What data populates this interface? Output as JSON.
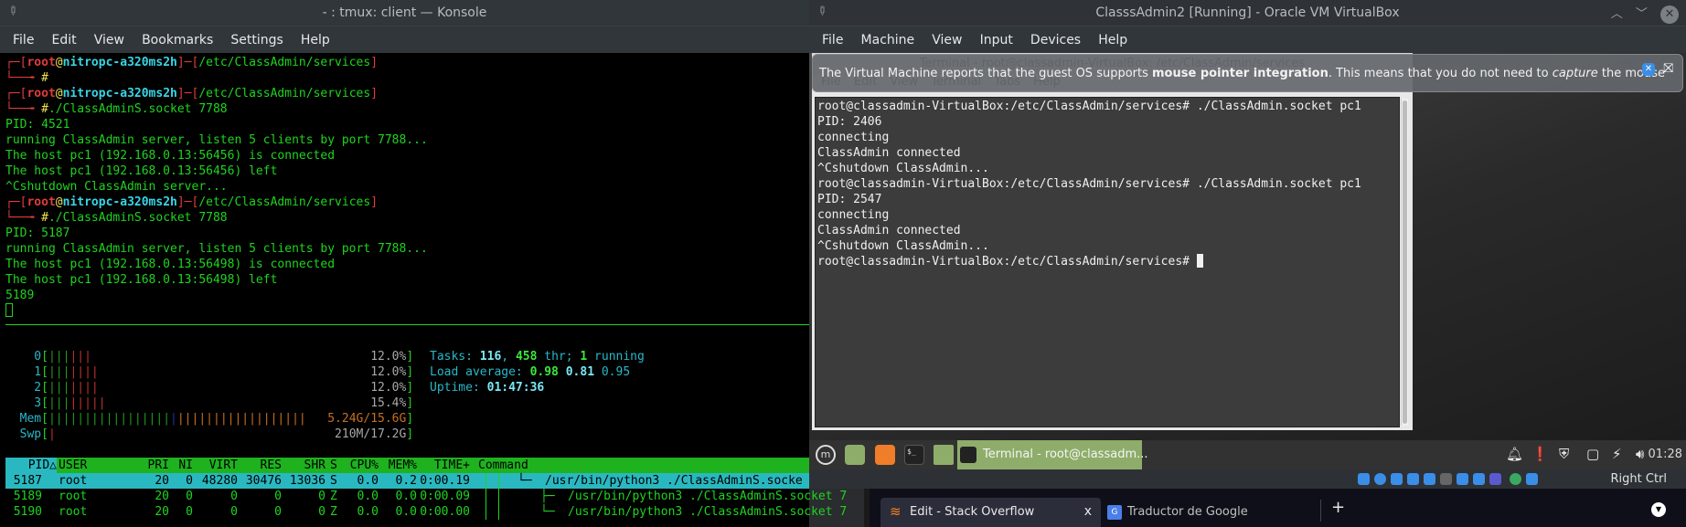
{
  "konsole": {
    "title": "- : tmux: client — Konsole",
    "menu": [
      "File",
      "Edit",
      "View",
      "Bookmarks",
      "Settings",
      "Help"
    ],
    "prompt": {
      "user": "root",
      "at": "@",
      "host": "nitropc-a320ms2h",
      "path": "/etc/ClassAdmin/services",
      "symbol": "#"
    },
    "lines": [
      {
        "type": "prompt"
      },
      {
        "type": "cmd",
        "text": ""
      },
      {
        "type": "prompt"
      },
      {
        "type": "cmd",
        "text": "./ClassAdminS.socket 7788"
      },
      {
        "type": "out",
        "text": "PID: 4521"
      },
      {
        "type": "out",
        "text": "running ClassAdmin server, listen 5 clients by port 7788..."
      },
      {
        "type": "out",
        "text": "The host pc1 (192.168.0.13:56456) is connected"
      },
      {
        "type": "out",
        "text": "The host pc1 (192.168.0.13:56456) left"
      },
      {
        "type": "out",
        "text": "^Cshutdown ClassAdmin server..."
      },
      {
        "type": "prompt"
      },
      {
        "type": "cmd",
        "text": "./ClassAdminS.socket 7788"
      },
      {
        "type": "out",
        "text": "PID: 5187"
      },
      {
        "type": "out",
        "text": "running ClassAdmin server, listen 5 clients by port 7788..."
      },
      {
        "type": "out",
        "text": "The host pc1 (192.168.0.13:56498) is connected"
      },
      {
        "type": "out",
        "text": "The host pc1 (192.168.0.13:56498) left"
      },
      {
        "type": "out",
        "text": "5189"
      }
    ]
  },
  "htop": {
    "cpus": [
      {
        "label": "0",
        "percent": "12.0%",
        "green_bars": 3,
        "red_bars": 3
      },
      {
        "label": "1",
        "percent": "12.0%",
        "green_bars": 3,
        "red_bars": 4
      },
      {
        "label": "2",
        "percent": "12.0%",
        "green_bars": 3,
        "red_bars": 4
      },
      {
        "label": "3",
        "percent": "15.4%",
        "green_bars": 3,
        "red_bars": 5
      }
    ],
    "mem": {
      "label": "Mem",
      "value": "5.24G/15.6G",
      "green_bars": 17,
      "blue_bars": 1,
      "orange_bars": 18
    },
    "swp": {
      "label": "Swp",
      "value": "210M/17.2G",
      "red_bars": 1
    },
    "tasks": {
      "label": "Tasks:",
      "count": "116",
      "threads": "458",
      "thr_label": "thr;",
      "running": "1",
      "running_label": "running"
    },
    "load": {
      "label": "Load average:",
      "l1": "0.98",
      "l5": "0.81",
      "l15": "0.95"
    },
    "uptime": {
      "label": "Uptime:",
      "value": "01:47:36"
    },
    "columns": [
      "PID",
      "USER",
      "PRI",
      "NI",
      "VIRT",
      "RES",
      "SHR",
      "S",
      "CPU%",
      "MEM%",
      "TIME+",
      "Command"
    ],
    "sort_indicator": "△",
    "processes": [
      {
        "pid": "5187",
        "user": "root",
        "pri": "20",
        "ni": "0",
        "virt": "48280",
        "res": "30476",
        "shr": "13036",
        "s": "S",
        "cpu": "0.0",
        "mem": "0.2",
        "time": "0:00.19",
        "tree": "└─",
        "command": "/usr/bin/python3 ./ClassAdminS.socke"
      },
      {
        "pid": "5189",
        "user": "root",
        "pri": "20",
        "ni": "0",
        "virt": "0",
        "res": "0",
        "shr": "0",
        "s": "Z",
        "cpu": "0.0",
        "mem": "0.0",
        "time": "0:00.09",
        "tree": "├─",
        "command": "/usr/bin/python3 ./ClassAdminS.socket 7"
      },
      {
        "pid": "5190",
        "user": "root",
        "pri": "20",
        "ni": "0",
        "virt": "0",
        "res": "0",
        "shr": "0",
        "s": "Z",
        "cpu": "0.0",
        "mem": "0.0",
        "time": "0:00.00",
        "tree": "└─",
        "command": "/usr/bin/python3 ./ClassAdminS.socket 7"
      }
    ]
  },
  "vbox": {
    "title": "ClasssAdmin2 [Running] - Oracle VM VirtualBox",
    "menu": [
      "File",
      "Machine",
      "View",
      "Input",
      "Devices",
      "Help"
    ],
    "notification": {
      "pre": "The Virtual Machine reports that the guest OS supports ",
      "bold": "mouse pointer integration",
      "mid": ". This means that you do not need to ",
      "italic": "capture",
      "post": " the mouse"
    },
    "guest_terminal": {
      "title": "Terminal - root@classadmin-VirtualBox: /etc/ClassAdmin/services",
      "menu": [
        "File",
        "Edit",
        "View",
        "Terminal",
        "Tabs",
        "Help"
      ],
      "lines": [
        "root@classadmin-VirtualBox:/etc/ClassAdmin/services# ./ClassAdmin.socket pc1",
        "PID: 2406",
        "connecting",
        "ClassAdmin connected",
        "^Cshutdown ClassAdmin...",
        "root@classadmin-VirtualBox:/etc/ClassAdmin/services# ./ClassAdmin.socket pc1",
        "PID: 2547",
        "connecting",
        "ClassAdmin connected",
        "^Cshutdown ClassAdmin...",
        "root@classadmin-VirtualBox:/etc/ClassAdmin/services# "
      ]
    },
    "taskbar": {
      "task_label": "Terminal - root@classadm...",
      "clock": "01:28"
    },
    "host_key": "Right Ctrl"
  },
  "browser": {
    "tabs": [
      {
        "label": "Edit - Stack Overflow",
        "active": true,
        "close": "x"
      },
      {
        "label": "Traductor de Google",
        "active": false
      }
    ],
    "new_tab": "+"
  }
}
